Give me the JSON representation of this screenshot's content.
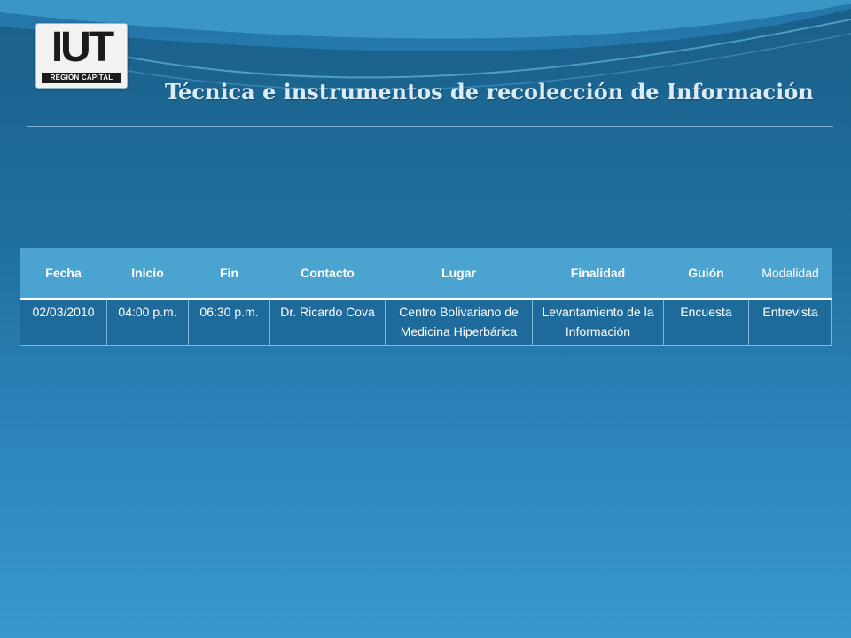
{
  "logo": {
    "main_text": "IUT",
    "subtitle": "REGIÓN CAPITAL"
  },
  "page": {
    "title": "Técnica e instrumentos de recolección de Información"
  },
  "table": {
    "headers": [
      "Fecha",
      "Inicio",
      "Fin",
      "Contacto",
      "Lugar",
      "Finalidad",
      "Guión",
      "Modalidad"
    ],
    "rows": [
      [
        "02/03/2010",
        "04:00 p.m.",
        "06:30 p.m.",
        "Dr. Ricardo Cova",
        "Centro Bolivariano de Medicina Hiperbárica",
        "Levantamiento de la Información",
        "Encuesta",
        "Entrevista"
      ]
    ]
  },
  "colors": {
    "header_fill": "#4ba3cf",
    "row_fill": "#1e6b9b",
    "title_text": "#d9ecf7"
  }
}
